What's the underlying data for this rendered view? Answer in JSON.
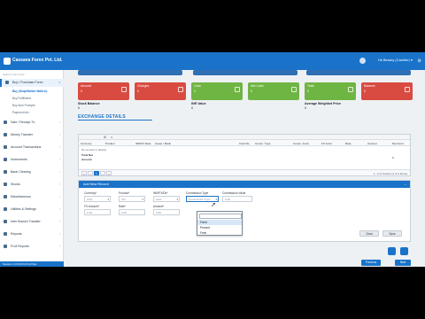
{
  "topbar": {
    "company": "Cassava Forex Pvt. Ltd.",
    "user": "Hk Beauty (Cashier) ▾"
  },
  "sidebar": {
    "search_placeholder": "Search menu here",
    "items": [
      {
        "label": "Buy / Purchase Forex",
        "active": true
      },
      {
        "label": "Sale / Receipt Tx",
        "active": false
      },
      {
        "label": "Money Transfer",
        "active": false
      },
      {
        "label": "Account Transactions",
        "active": false
      },
      {
        "label": "Instruments",
        "active": false
      },
      {
        "label": "Bank Clearing",
        "active": false
      },
      {
        "label": "Stocks",
        "active": false
      },
      {
        "label": "Miscellaneous",
        "active": false
      },
      {
        "label": "Utilities & Settings",
        "active": false
      },
      {
        "label": "Inter Branch Transfer",
        "active": false
      },
      {
        "label": "Reports",
        "active": false
      },
      {
        "label": "FLM Reports",
        "active": false
      }
    ],
    "subitems": [
      {
        "label": "Buy (Swip/Walkin Walk In)",
        "active": true
      },
      {
        "label": "Buy Fulfillment",
        "active": false
      },
      {
        "label": "Buy Auto Prompts",
        "active": false
      },
      {
        "label": "Payment Info",
        "active": false
      }
    ],
    "status": "Session 1 15:00 Fri 8:43 Sec"
  },
  "stats": [
    {
      "title": "Amount",
      "value": "0",
      "color": "#d94b41"
    },
    {
      "title": "Charges",
      "value": "0",
      "color": "#d94b41"
    },
    {
      "title": "Cash",
      "value": "0",
      "color": "#6fb543"
    },
    {
      "title": "Net Cash",
      "value": "0",
      "color": "#6fb543"
    },
    {
      "title": "Total",
      "value": "0",
      "color": "#6fb543"
    },
    {
      "title": "Balance",
      "value": "0",
      "color": "#d94b41"
    }
  ],
  "summary": [
    {
      "label": "Stock Balance",
      "value": "0"
    },
    {
      "label": "INR Value",
      "value": "0"
    },
    {
      "label": "Average Weighted Price",
      "value": "0"
    }
  ],
  "section_title": "EXCHANGE DETAILS",
  "grid": {
    "headers": [
      "Currency",
      "Product",
      "INR/FX Rate",
      "Issuer / Bank",
      "Card No.",
      "Comm. Type",
      "Comm. Amnt",
      "FX Amnt",
      "Rate",
      "Amount",
      "Net Amnt"
    ],
    "empty_text": "No records to display",
    "total_lines": [
      "Total Net",
      "Amount"
    ],
    "total_value": "0",
    "page": "1",
    "pager_info": "1 - 0 of 0 items (1 of 1 items)"
  },
  "add_panel": {
    "title": "Add New Record",
    "fields": [
      {
        "label": "Currency*",
        "value": "USA",
        "dropdown": true
      },
      {
        "label": "Product*",
        "value": "CN",
        "dropdown": true
      },
      {
        "label": "INR/FX/Dir*",
        "value": "USA",
        "dropdown": true
      },
      {
        "label": "Commission Type",
        "value": "Commission Type",
        "dropdown": true
      },
      {
        "label": "Commission Value",
        "value": "0.00",
        "dropdown": false
      },
      {
        "label": "FX Amount*",
        "value": "0.00",
        "dropdown": false
      },
      {
        "label": "Rate*",
        "value": "0.00",
        "dropdown": false
      },
      {
        "label": "Amount*",
        "value": "0.00",
        "dropdown": false
      }
    ],
    "dropdown_options": [
      "Fixed",
      "Percent",
      "Fees"
    ],
    "buttons": [
      "Clear",
      "Save"
    ]
  },
  "bottom_buttons": [
    "Previous",
    "Next"
  ]
}
